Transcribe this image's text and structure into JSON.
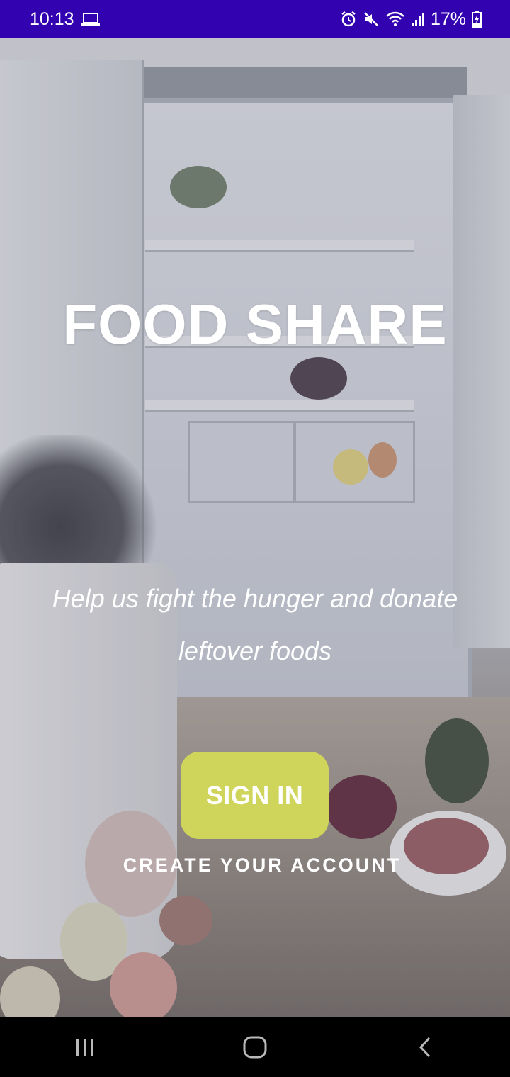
{
  "status_bar": {
    "time": "10:13",
    "battery": "17%",
    "icons": [
      "laptop-icon",
      "alarm-icon",
      "mute-icon",
      "wifi-icon",
      "signal-icon",
      "battery-charging-icon"
    ],
    "background_color": "#3202b0"
  },
  "main": {
    "app_title": "FOOD SHARE",
    "tagline": "Help us fight the hunger and donate leftover foods",
    "sign_in_label": "SIGN IN",
    "create_account_label": "CREATE YOUR ACCOUNT",
    "accent_color": "#cfd45a"
  },
  "nav_bar": {
    "icons": [
      "recent-apps-icon",
      "home-icon",
      "back-icon"
    ]
  }
}
